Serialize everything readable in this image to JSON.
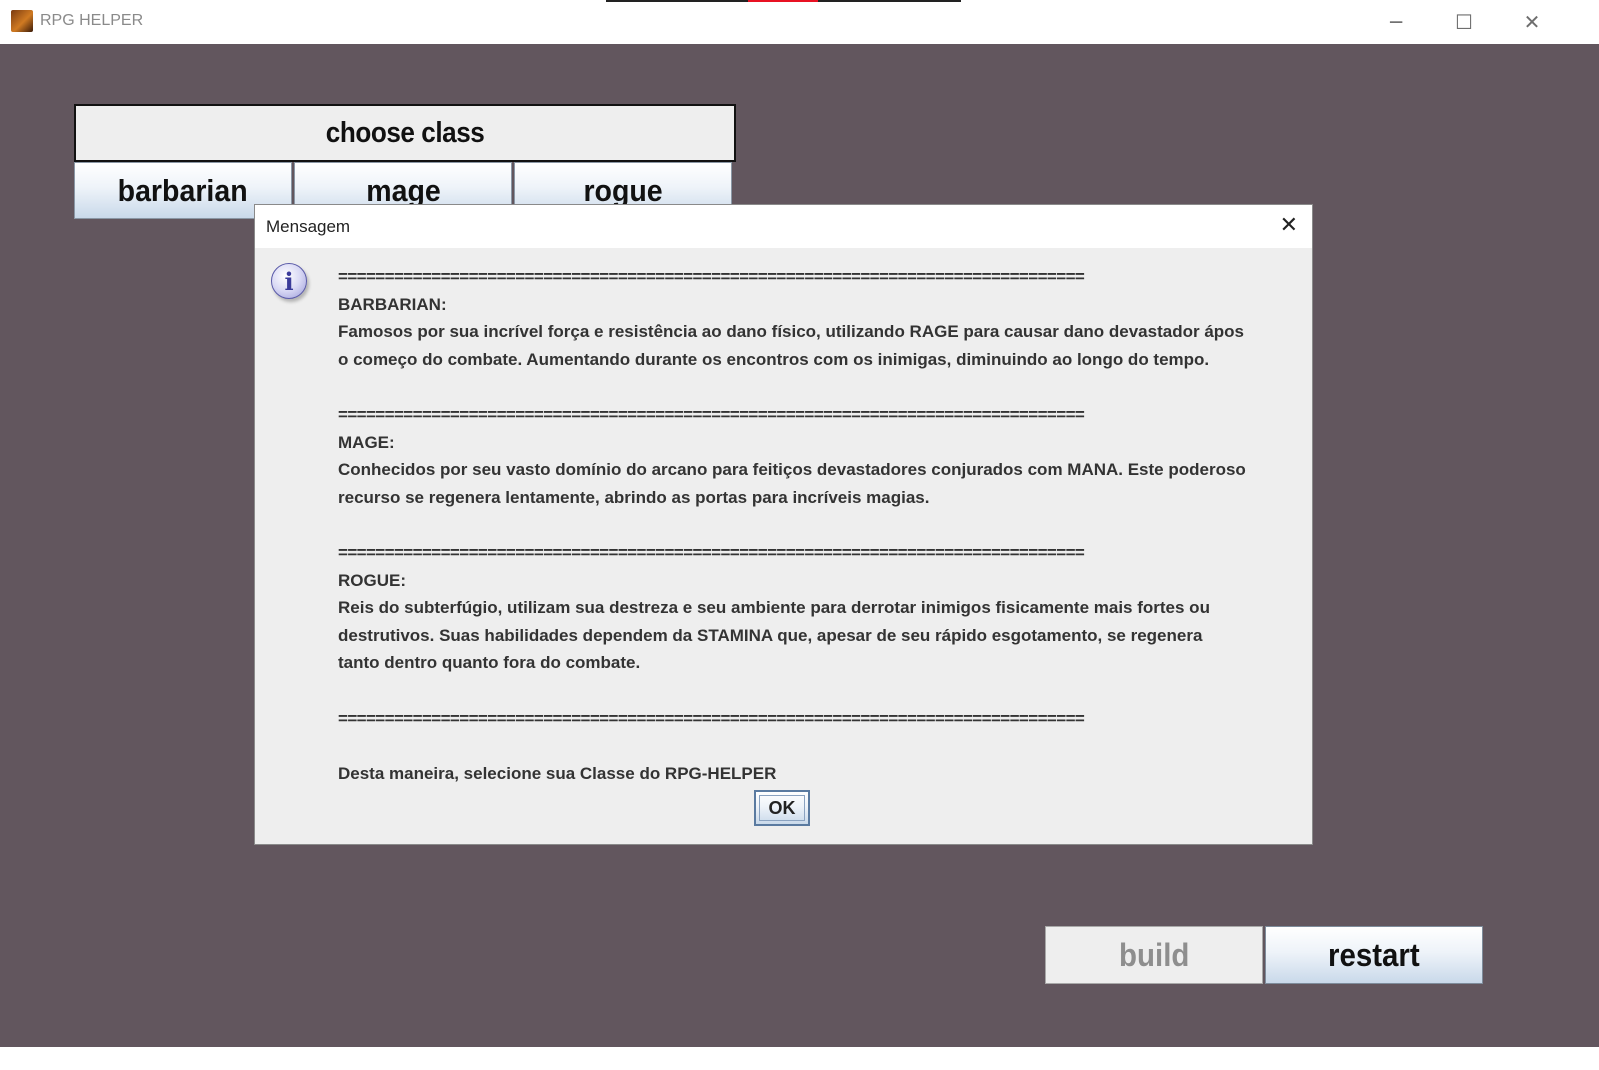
{
  "window": {
    "title": "RPG HELPER",
    "controls": {
      "minimize_icon": "─",
      "maximize_icon": "☐",
      "close_icon": "✕"
    }
  },
  "main": {
    "header": "choose class",
    "class_buttons": [
      {
        "label": "barbarian"
      },
      {
        "label": "mage"
      },
      {
        "label": "rogue"
      }
    ],
    "build_label": "build",
    "restart_label": "restart"
  },
  "dialog": {
    "title": "Mensagem",
    "close_icon": "✕",
    "info_glyph": "i",
    "separator": "================================================================================",
    "lines": [
      "BARBARIAN:",
      "Famosos por sua incrível força e resistência ao dano físico, utilizando RAGE para causar dano devastador ápos",
      "o começo do combate. Aumentando durante os encontros com os inimigas, diminuindo ao longo do tempo.",
      "MAGE:",
      "Conhecidos por seu vasto domínio do arcano para feitiços devastadores conjurados com MANA. Este poderoso",
      "recurso se regenera lentamente, abrindo as portas para incríveis magias.",
      "ROGUE:",
      "Reis do subterfúgio, utilizam sua destreza e seu ambiente para derrotar inimigos fisicamente mais fortes ou",
      "destrutivos. Suas habilidades dependem da STAMINA que, apesar de seu rápido esgotamento, se regenera",
      "tanto dentro quanto fora do combate.",
      "Desta maneira, selecione sua Classe do RPG-HELPER"
    ],
    "ok_label": "OK"
  },
  "colors": {
    "background": "#62565e",
    "panel": "#eeeeee",
    "button_gradient_bottom": "#c9d9ea",
    "disabled_text": "#8e8e8e"
  }
}
